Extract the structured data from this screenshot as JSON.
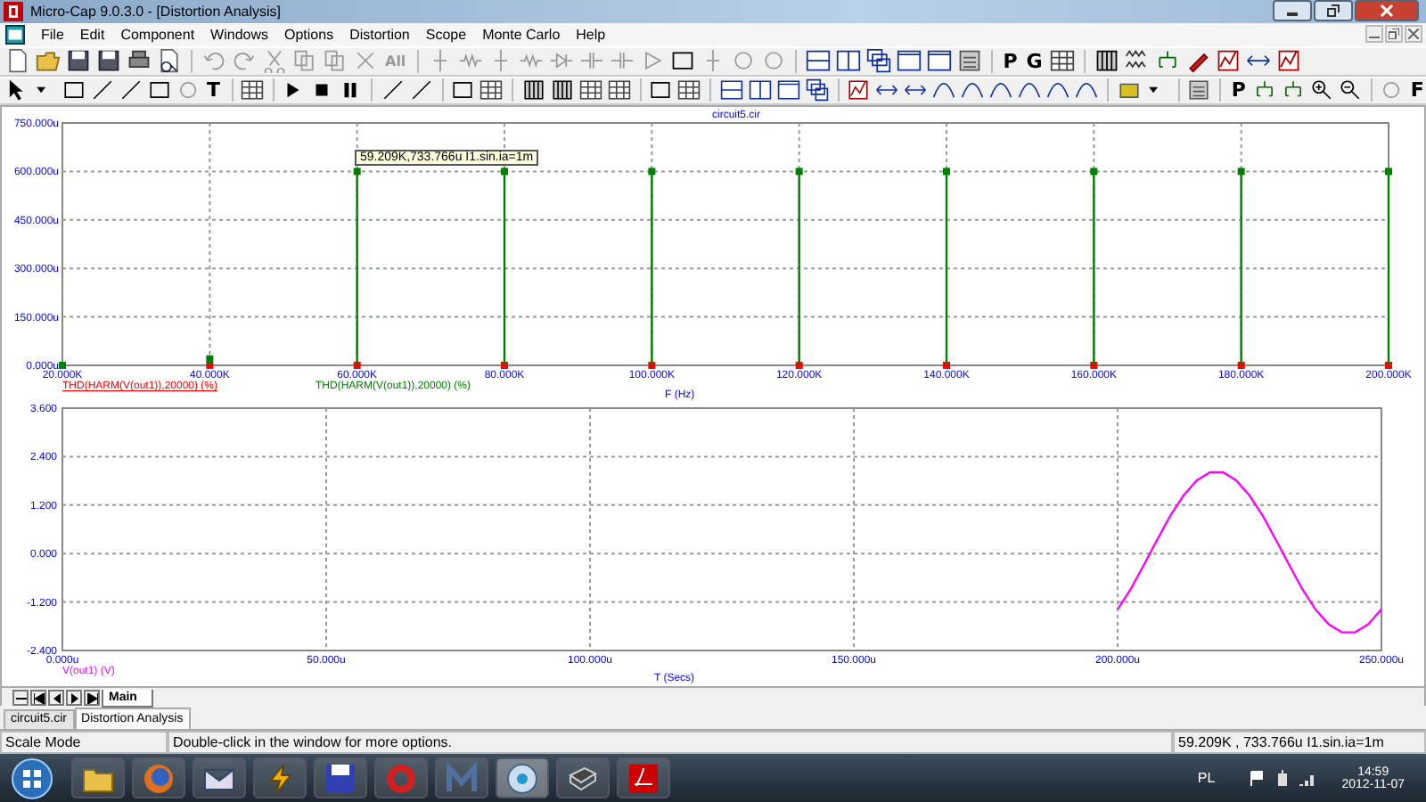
{
  "window": {
    "title": "Micro-Cap 9.0.3.0 - [Distortion Analysis]"
  },
  "menu": [
    "File",
    "Edit",
    "Component",
    "Windows",
    "Options",
    "Distortion",
    "Scope",
    "Monte Carlo",
    "Help"
  ],
  "toolbar1": {
    "text_buttons": [
      {
        "label": "All",
        "disabled": true
      },
      {
        "label": "P",
        "disabled": false
      },
      {
        "label": "G",
        "disabled": false
      }
    ]
  },
  "toolbar2": {
    "text_buttons": [
      {
        "label": "T",
        "disabled": false
      },
      {
        "label": "P",
        "disabled": false
      },
      {
        "label": "F",
        "disabled": false
      }
    ]
  },
  "plot_top": {
    "tooltip": "59.209K,733.766u I1.sin.ia=1m",
    "chart_data": {
      "type": "scatter",
      "title": "circuit5.cir",
      "xlabel": "F (Hz)",
      "x": [
        20,
        40,
        60,
        80,
        100,
        120,
        140,
        160,
        180,
        200
      ],
      "series": [
        {
          "name": "THD(HARM(V(out1)),20000) (%)",
          "color": "#ff0000",
          "values": [
            null,
            0,
            0,
            0,
            0,
            0,
            0,
            0,
            0,
            0
          ]
        },
        {
          "name": "THD(HARM(V(out1)),20000) (%)",
          "color": "#008000",
          "values": [
            0,
            20,
            600,
            600,
            600,
            600,
            600,
            600,
            600,
            600
          ]
        }
      ],
      "xlim": [
        20,
        200
      ],
      "ylim": [
        0,
        750
      ],
      "grid": true,
      "xticks": [
        {
          "value": 20,
          "label": "20.000K"
        },
        {
          "value": 40,
          "label": "40.000K"
        },
        {
          "value": 60,
          "label": "60.000K"
        },
        {
          "value": 80,
          "label": "80.000K"
        },
        {
          "value": 100,
          "label": "100.000K"
        },
        {
          "value": 120,
          "label": "120.000K"
        },
        {
          "value": 140,
          "label": "140.000K"
        },
        {
          "value": 160,
          "label": "160.000K"
        },
        {
          "value": 180,
          "label": "180.000K"
        },
        {
          "value": 200,
          "label": "200.000K"
        }
      ],
      "yticks": [
        {
          "value": 0,
          "label": "0.000u"
        },
        {
          "value": 150,
          "label": "150.000u"
        },
        {
          "value": 300,
          "label": "300.000u"
        },
        {
          "value": 450,
          "label": "450.000u"
        },
        {
          "value": 600,
          "label": "600.000u"
        },
        {
          "value": 750,
          "label": "750.000u"
        }
      ]
    }
  },
  "plot_bottom": {
    "chart_data": {
      "type": "line",
      "xlabel": "T (Secs)",
      "x": [
        200,
        202.5,
        205,
        207.5,
        210,
        212.5,
        215,
        217.5,
        220,
        222.5,
        225,
        227.5,
        230,
        232.5,
        235,
        237.5,
        240,
        242.5,
        245,
        247.5,
        250
      ],
      "series": [
        {
          "name": "V(out1) (V)",
          "color": "#ff00ff",
          "values": [
            -1.38,
            -0.88,
            -0.28,
            0.34,
            0.94,
            1.44,
            1.81,
            2.01,
            2.01,
            1.81,
            1.44,
            0.94,
            0.34,
            -0.28,
            -0.88,
            -1.38,
            -1.75,
            -1.95,
            -1.95,
            -1.75,
            -1.38
          ]
        }
      ],
      "xlim": [
        0,
        250
      ],
      "ylim": [
        -2.4,
        3.6
      ],
      "grid": true,
      "xticks": [
        {
          "value": 0,
          "label": "0.000u"
        },
        {
          "value": 50,
          "label": "50.000u"
        },
        {
          "value": 100,
          "label": "100.000u"
        },
        {
          "value": 150,
          "label": "150.000u"
        },
        {
          "value": 200,
          "label": "200.000u"
        },
        {
          "value": 250,
          "label": "250.000u"
        }
      ],
      "yticks": [
        {
          "value": -2.4,
          "label": "-2.400"
        },
        {
          "value": -1.2,
          "label": "-1.200"
        },
        {
          "value": 0,
          "label": "0.000"
        },
        {
          "value": 1.2,
          "label": "1.200"
        },
        {
          "value": 2.4,
          "label": "2.400"
        },
        {
          "value": 3.6,
          "label": "3.600"
        }
      ]
    }
  },
  "page_tabs": [
    {
      "label": "Main",
      "selected": true
    }
  ],
  "document_tabs": [
    {
      "label": "circuit5.cir",
      "selected": false
    },
    {
      "label": "Distortion Analysis",
      "selected": true
    }
  ],
  "status_bar": {
    "mode": "Scale Mode",
    "hint": "Double-click in the window for more options.",
    "cursor": "59.209K , 733.766u  I1.sin.ia=1m"
  },
  "taskbar": {
    "language": "PL",
    "time": "14:59",
    "date": "2012-11-07"
  }
}
